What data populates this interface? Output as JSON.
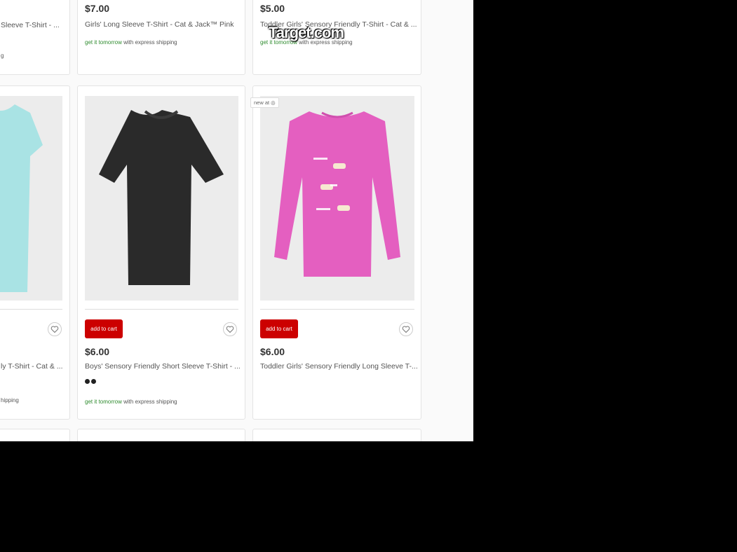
{
  "watermark": "Target.com",
  "top_row": [
    {
      "title": "Sleeve T-Shirt - ...",
      "shipping_extra": "g"
    },
    {
      "price": "$7.00",
      "title": "Girls' Long Sleeve T-Shirt - Cat & Jack™ Pink",
      "ship_green": "get it tomorrow",
      "ship_rest": " with express shipping"
    },
    {
      "price": "$5.00",
      "title": "Toddler Girls' Sensory Friendly T-Shirt - Cat & ...",
      "ship_green": "get it tomorrow",
      "ship_rest": " with express shipping"
    }
  ],
  "mid_row": [
    {
      "title": "ly T-Shirt - Cat & ...",
      "ship_rest": "hipping"
    },
    {
      "button": "add to cart",
      "price": "$6.00",
      "title": "Boys' Sensory Friendly Short Sleeve T-Shirt - ...",
      "ship_green": "get it tomorrow",
      "ship_rest": " with express shipping",
      "swatches": [
        "#222222",
        "#222222"
      ]
    },
    {
      "badge": "new at ◎",
      "button": "add to cart",
      "price": "$6.00",
      "title": "Toddler Girls' Sensory Friendly Long Sleeve T-..."
    }
  ],
  "icons": {
    "favorite": "heart-icon",
    "target": "target-logo-icon"
  },
  "colors": {
    "accent": "#cc0000",
    "ship_green": "#2e8b2e",
    "shirt_mint": "#a9e3e4",
    "shirt_black": "#2a2a2a",
    "shirt_pink": "#e45fc0"
  }
}
